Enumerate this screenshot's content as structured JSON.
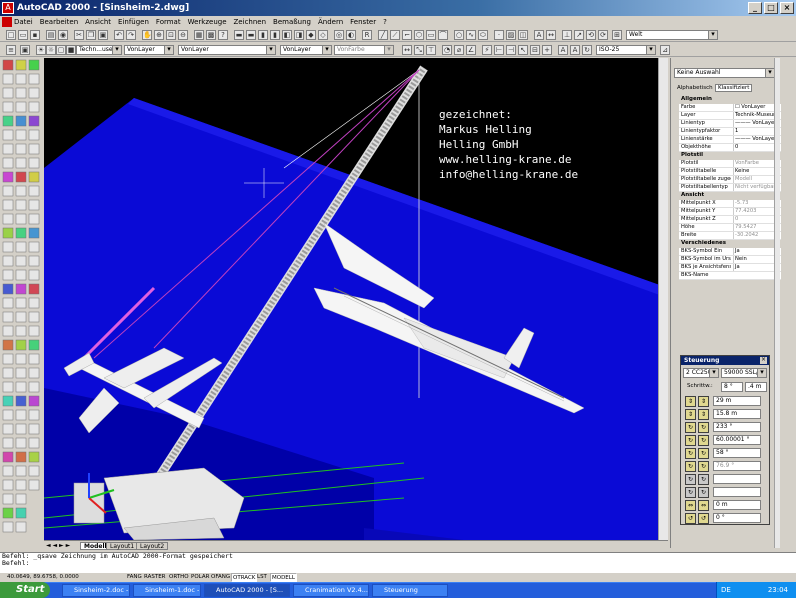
{
  "window": {
    "title": "AutoCAD 2000 - [Sinsheim-2.dwg]"
  },
  "menu": [
    "Datei",
    "Bearbeiten",
    "Ansicht",
    "Einfügen",
    "Format",
    "Werkzeuge",
    "Zeichnen",
    "Bemaßung",
    "Ändern",
    "Fenster",
    "?"
  ],
  "toolbar": {
    "ucs_combo": "Welt",
    "layer_combo": "Techn...useum",
    "color_combo": "VonLayer",
    "linetype_combo": "VonLayer",
    "lineweight_combo": "VonLayer",
    "plotstyle_combo": "VonFarbe",
    "dimstyle_combo": "ISO-25"
  },
  "viewport": {
    "overlay_lines": [
      "gezeichnet:",
      "Markus Helling",
      "Helling GmbH",
      "www.helling-krane.de",
      "info@helling-krane.de"
    ],
    "tabs": [
      "Modell",
      "Layout1",
      "Layout2"
    ]
  },
  "properties": {
    "selection": "Keine Auswahl",
    "tab_alpha": "Alphabetisch",
    "tab_cat": "Klassifiziert",
    "sections": [
      {
        "title": "Allgemein",
        "rows": [
          [
            "Farbe",
            "☐ VonLayer"
          ],
          [
            "Layer",
            "Technik-Museum"
          ],
          [
            "Linientyp",
            "——— VonLayer"
          ],
          [
            "Linientypfaktor",
            "1"
          ],
          [
            "Linienstärke",
            "——— VonLayer"
          ],
          [
            "Objekthöhe",
            "0"
          ]
        ]
      },
      {
        "title": "Plotstil",
        "rows": [
          [
            "Plotstil",
            "VonFarbe"
          ],
          [
            "Plotstiltabelle",
            "Keine"
          ],
          [
            "Plotstiltabelle zugeordn",
            "Modell"
          ],
          [
            "Plotstiltabellentyp",
            "Nicht verfügbar"
          ]
        ]
      },
      {
        "title": "Ansicht",
        "rows": [
          [
            "Mittelpunkt X",
            "-5.73"
          ],
          [
            "Mittelpunkt Y",
            "77.4203"
          ],
          [
            "Mittelpunkt Z",
            "0"
          ],
          [
            "Höhe",
            "79.5427"
          ],
          [
            "Breite",
            "-30.2042"
          ]
        ]
      },
      {
        "title": "Verschiedenes",
        "rows": [
          [
            "BKS-Symbol Ein",
            "Ja"
          ],
          [
            "BKS-Symbol im Ursprung",
            "Nein"
          ],
          [
            "BKS je Ansichtsfenster",
            "Ja"
          ],
          [
            "BKS-Name",
            ""
          ]
        ]
      }
    ]
  },
  "steuerung": {
    "title": "Steuerung",
    "crane_combo": "2 CC2500",
    "config_combo": "59000 SSL/LSL",
    "schritt_label": "Schrittw.:",
    "schritt_deg": "8 °",
    "schritt_m": ".4 m",
    "values": [
      "29 m",
      "15.8 m",
      "233 °",
      "60.00001 °",
      "58 °",
      "76.9 °",
      "",
      "",
      "0 m",
      "0 °"
    ]
  },
  "command": {
    "lines": [
      "Befehl: _qsave Zeichnung im AutoCAD 2000-Format gespeichert",
      "Befehl:"
    ]
  },
  "status": {
    "coords": "40.0649, 89.6758, 0.0000",
    "buttons": [
      "FANG",
      "RASTER",
      "ORTHO",
      "POLAR",
      "OFANG",
      "OTRACK",
      "LST",
      "MODELL"
    ]
  },
  "taskbar": {
    "start": "Start",
    "tasks": [
      "Sinsheim-2.doc - ...",
      "Sinsheim-1.doc - ...",
      "AutoCAD 2000 - [S...",
      "Cranimation V2.4...",
      "Steuerung"
    ],
    "lang": "DE",
    "time": "23:04"
  }
}
